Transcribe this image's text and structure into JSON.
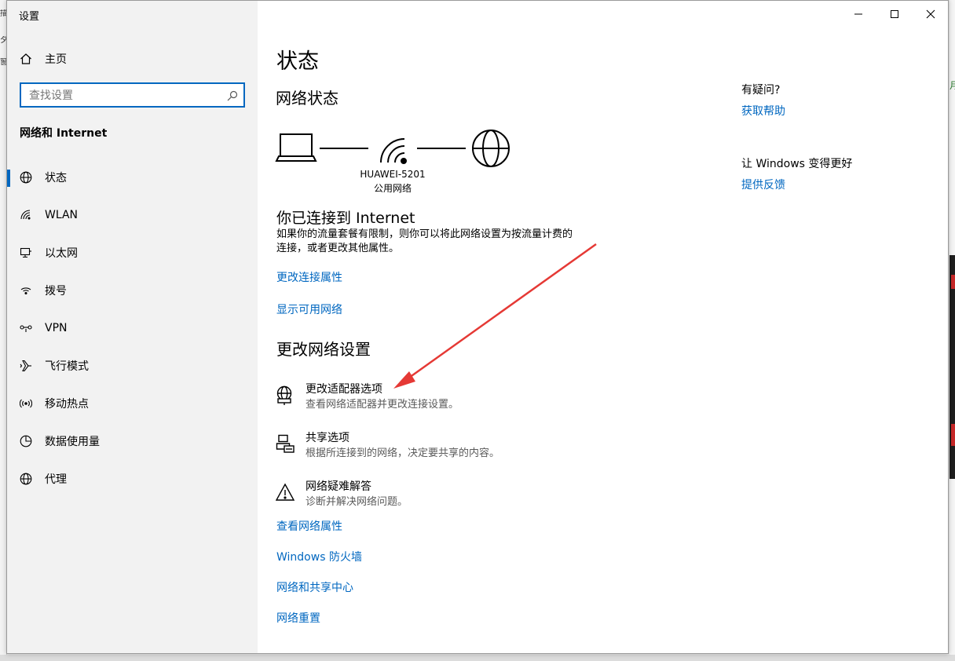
{
  "window": {
    "title": "设置"
  },
  "sidebar": {
    "home_label": "主页",
    "search_placeholder": "查找设置",
    "section_title": "网络和 Internet",
    "items": [
      {
        "label": "状态",
        "icon": "globe-icon",
        "active": true
      },
      {
        "label": "WLAN",
        "icon": "wifi-icon",
        "active": false
      },
      {
        "label": "以太网",
        "icon": "ethernet-icon",
        "active": false
      },
      {
        "label": "拨号",
        "icon": "dialup-icon",
        "active": false
      },
      {
        "label": "VPN",
        "icon": "vpn-icon",
        "active": false
      },
      {
        "label": "飞行模式",
        "icon": "airplane-icon",
        "active": false
      },
      {
        "label": "移动热点",
        "icon": "hotspot-icon",
        "active": false
      },
      {
        "label": "数据使用量",
        "icon": "data-usage-icon",
        "active": false
      },
      {
        "label": "代理",
        "icon": "globe-icon",
        "active": false
      }
    ]
  },
  "main": {
    "title": "状态",
    "network_status_heading": "网络状态",
    "network_name": "HUAWEI-5201",
    "network_type": "公用网络",
    "connected_heading": "你已连接到 Internet",
    "connected_desc_line1": "如果你的流量套餐有限制，则你可以将此网络设置为按流量计费的",
    "connected_desc_line2": "连接，或者更改其他属性。",
    "link_change_connection": "更改连接属性",
    "link_show_networks": "显示可用网络",
    "change_settings_heading": "更改网络设置",
    "options": [
      {
        "title": "更改适配器选项",
        "desc": "查看网络适配器并更改连接设置。",
        "icon": "adapter-icon"
      },
      {
        "title": "共享选项",
        "desc": "根据所连接到的网络，决定要共享的内容。",
        "icon": "sharing-icon"
      },
      {
        "title": "网络疑难解答",
        "desc": "诊断并解决网络问题。",
        "icon": "warning-icon"
      }
    ],
    "links_bottom": [
      "查看网络属性",
      "Windows 防火墙",
      "网络和共享中心",
      "网络重置"
    ]
  },
  "right_panel": {
    "question": "有疑问?",
    "get_help": "获取帮助",
    "improve": "让 Windows 变得更好",
    "feedback": "提供反馈"
  },
  "colors": {
    "accent": "#0067c0",
    "sidebar_bg": "#f2f2f2",
    "annotation_arrow": "#e53935"
  }
}
